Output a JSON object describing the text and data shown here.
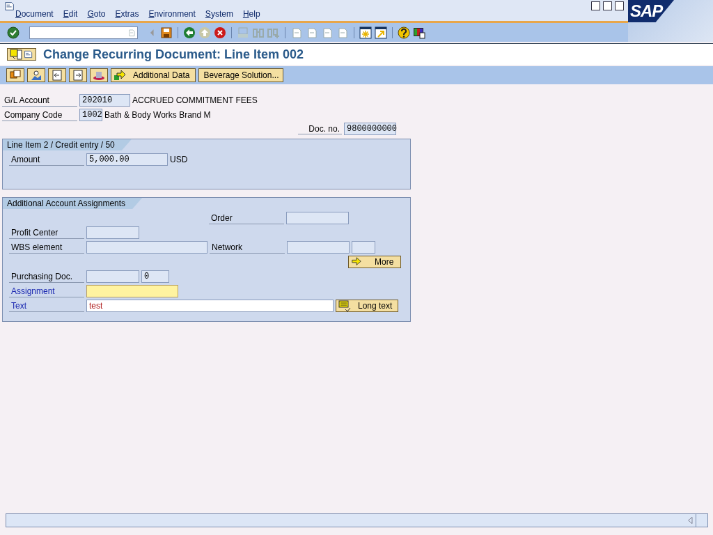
{
  "menu": [
    "Document",
    "Edit",
    "Goto",
    "Extras",
    "Environment",
    "System",
    "Help"
  ],
  "logo": "SAP",
  "title": "Change Recurring Document: Line Item 002",
  "app_toolbar": {
    "buttons": [
      "Additional Data",
      "Beverage Solution..."
    ]
  },
  "header": {
    "gl_account": {
      "label": "G/L Account",
      "value": "202010",
      "description": "ACCRUED COMMITMENT FEES"
    },
    "company_code": {
      "label": "Company Code",
      "value": "1002",
      "description": "Bath & Body Works Brand M"
    },
    "doc_no": {
      "label": "Doc. no.",
      "value": "9800000000"
    }
  },
  "line_item": {
    "title": "Line Item 2 / Credit entry / 50",
    "amount": {
      "label": "Amount",
      "value": "5,000.00",
      "currency": "USD"
    }
  },
  "assignments": {
    "title": "Additional Account Assignments",
    "order": {
      "label": "Order"
    },
    "profit_center": {
      "label": "Profit Center"
    },
    "wbs_element": {
      "label": "WBS element"
    },
    "network": {
      "label": "Network"
    },
    "more_button": "More",
    "purchasing_doc": {
      "label": "Purchasing Doc.",
      "item": "0"
    },
    "assignment": {
      "label": "Assignment",
      "emphasized": true,
      "focused": true
    },
    "text": {
      "label": "Text",
      "emphasized": true,
      "focused": false,
      "value": "test"
    },
    "long_text_button": "Long text"
  }
}
